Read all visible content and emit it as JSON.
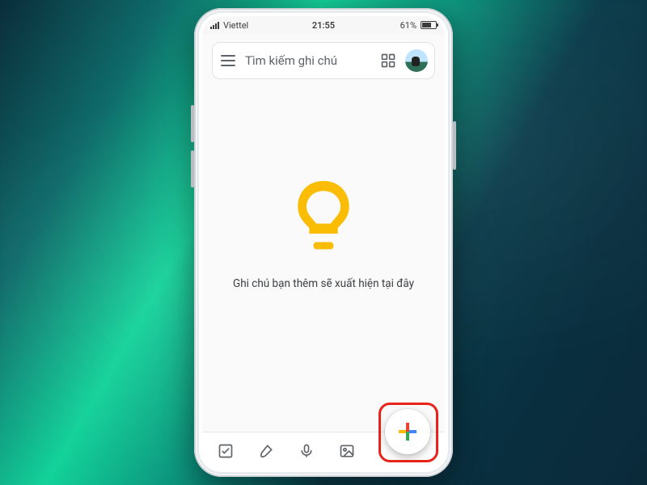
{
  "statusbar": {
    "carrier": "Viettel",
    "time": "21:55",
    "battery_pct": "61%"
  },
  "header": {
    "search_placeholder": "Tìm kiếm ghi chú"
  },
  "empty": {
    "message": "Ghi chú bạn thêm sẽ xuất hiện tại đây"
  },
  "toolbar": {
    "checkbox": "checkbox-icon",
    "brush": "brush-icon",
    "mic": "mic-icon",
    "image": "image-icon",
    "fab": "add-note"
  },
  "colors": {
    "accent_yellow": "#fbbc04",
    "google_red": "#ea4335",
    "google_blue": "#4285f4",
    "google_green": "#34a853",
    "google_yellow": "#fbbc04",
    "highlight": "#e8231a"
  }
}
